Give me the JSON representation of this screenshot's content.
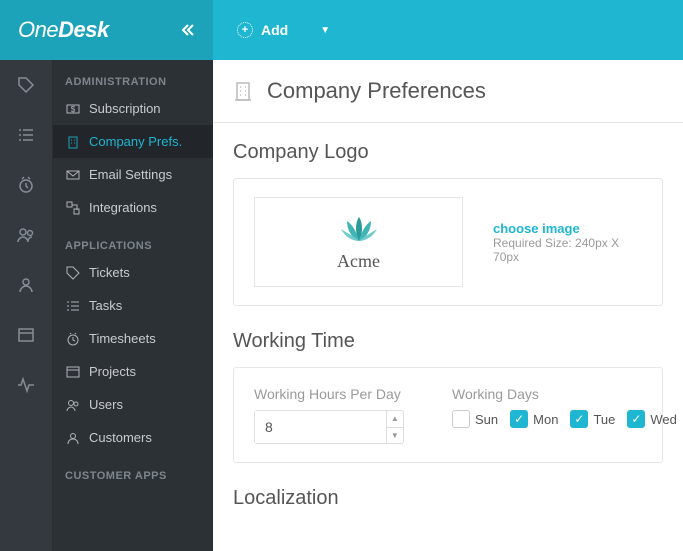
{
  "topbar": {
    "brand_a": "One",
    "brand_b": "Desk",
    "add_label": "Add"
  },
  "sidebar": {
    "group_admin": "ADMINISTRATION",
    "group_apps": "APPLICATIONS",
    "group_cust": "CUSTOMER APPS",
    "admin_items": [
      {
        "label": "Subscription"
      },
      {
        "label": "Company Prefs."
      },
      {
        "label": "Email Settings"
      },
      {
        "label": "Integrations"
      }
    ],
    "app_items": [
      {
        "label": "Tickets"
      },
      {
        "label": "Tasks"
      },
      {
        "label": "Timesheets"
      },
      {
        "label": "Projects"
      },
      {
        "label": "Users"
      },
      {
        "label": "Customers"
      }
    ]
  },
  "main": {
    "title": "Company Preferences",
    "logo_section": "Company Logo",
    "logo_name": "Acme",
    "choose": "choose image",
    "required": "Required Size: 240px X 70px",
    "working_section": "Working Time",
    "wh_label": "Working Hours Per Day",
    "wh_value": "8",
    "wd_label": "Working Days",
    "days": [
      {
        "label": "Sun",
        "checked": false
      },
      {
        "label": "Mon",
        "checked": true
      },
      {
        "label": "Tue",
        "checked": true
      },
      {
        "label": "Wed",
        "checked": true
      }
    ],
    "localization_section": "Localization"
  }
}
